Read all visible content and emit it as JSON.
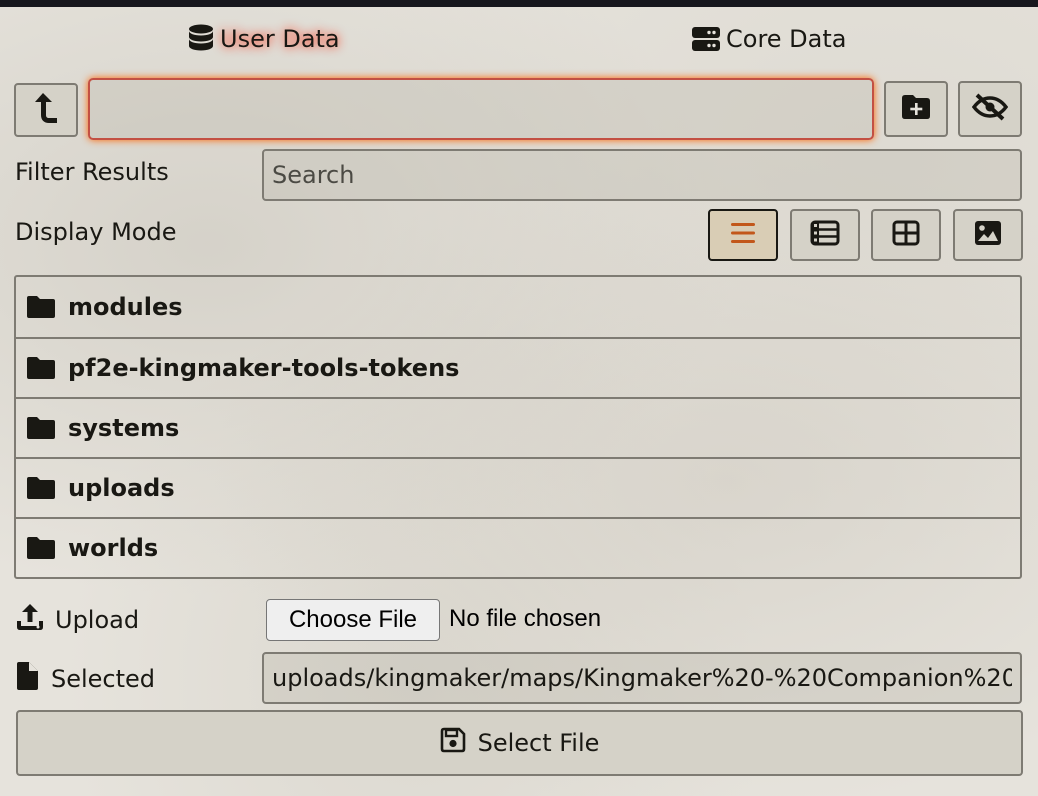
{
  "tabs": [
    {
      "label": "User Data",
      "icon": "database-icon",
      "active": true
    },
    {
      "label": "Core Data",
      "icon": "server-icon",
      "active": false
    }
  ],
  "filter": {
    "label": "Filter Results",
    "placeholder": "Search"
  },
  "display": {
    "label": "Display Mode",
    "modes": [
      "list",
      "thumbs",
      "tiles",
      "images"
    ],
    "active": "list"
  },
  "directories": [
    {
      "name": "modules"
    },
    {
      "name": "pf2e-kingmaker-tools-tokens"
    },
    {
      "name": "systems"
    },
    {
      "name": "uploads"
    },
    {
      "name": "worlds"
    }
  ],
  "upload": {
    "label": "Upload",
    "choose_label": "Choose File",
    "status": "No file chosen"
  },
  "selected": {
    "label": "Selected",
    "value": "uploads/kingmaker/maps/Kingmaker%20-%20Companion%20"
  },
  "select_button": {
    "label": "Select File"
  },
  "colors": {
    "accent_glow": "#ff6400",
    "panel": "#e6e3dc",
    "border": "#7e7b73"
  }
}
